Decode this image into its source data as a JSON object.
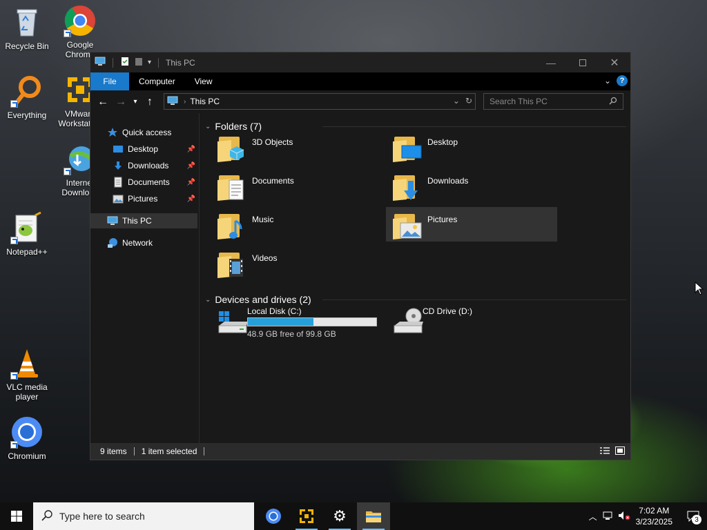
{
  "desktop": {
    "icons": [
      {
        "label": "Recycle Bin"
      },
      {
        "label": "Google Chrome"
      },
      {
        "label": "Everything"
      },
      {
        "label": "VMware Workstation"
      },
      {
        "label": "Internet Download"
      },
      {
        "label": "Notepad++"
      },
      {
        "label": "VLC media player"
      },
      {
        "label": "Chromium"
      }
    ]
  },
  "window": {
    "title": "This PC",
    "ribbon_tabs": [
      "File",
      "Computer",
      "View"
    ],
    "address": {
      "crumb": "This PC"
    },
    "search_placeholder": "Search This PC",
    "nav": {
      "quick_access": "Quick access",
      "pinned": [
        "Desktop",
        "Downloads",
        "Documents",
        "Pictures"
      ],
      "this_pc": "This PC",
      "network": "Network"
    },
    "folders_header": "Folders (7)",
    "folders": [
      "3D Objects",
      "Desktop",
      "Documents",
      "Downloads",
      "Music",
      "Pictures",
      "Videos"
    ],
    "drives_header": "Devices and drives (2)",
    "drives": [
      {
        "name": "Local Disk (C:)",
        "free_text": "48.9 GB free of 99.8 GB",
        "used_fraction": 0.51
      },
      {
        "name": "CD Drive (D:)"
      }
    ],
    "status": {
      "items": "9 items",
      "selected": "1 item selected"
    }
  },
  "taskbar": {
    "search_placeholder": "Type here to search",
    "time": "7:02 AM",
    "date": "3/23/2025",
    "notifications": "3"
  },
  "colors": {
    "accent": "#1979ca",
    "drive_fill": "#26a0da",
    "folder": "#e8b84a"
  }
}
